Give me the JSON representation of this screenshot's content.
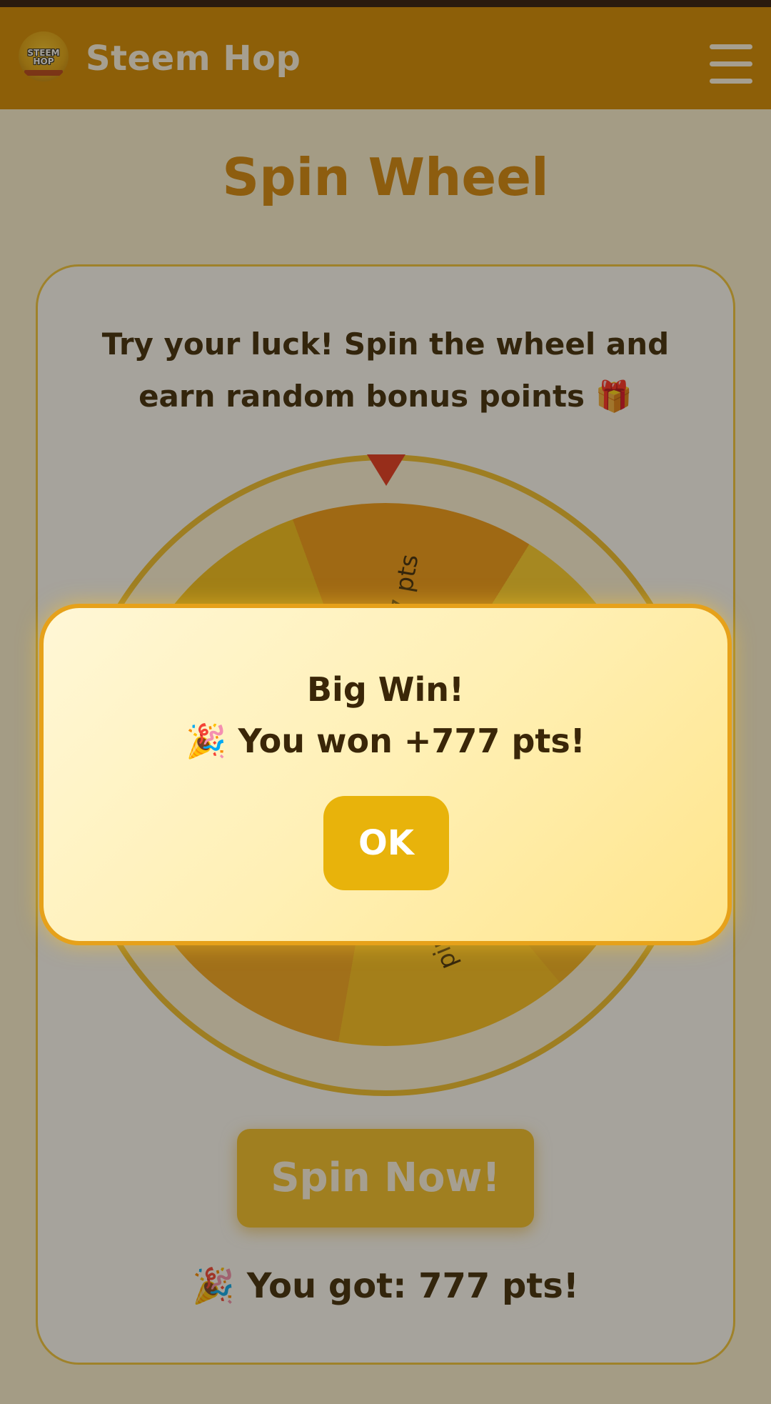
{
  "header": {
    "app_title": "Steem Hop",
    "logo_text": "STEEM HOP",
    "menu_icon": "hamburger-menu-icon"
  },
  "page": {
    "title": "Spin Wheel",
    "intro_line1": "Try your luck! Spin the wheel and",
    "intro_line2": "earn random bonus points 🎁"
  },
  "wheel": {
    "labels": [
      "7 pts",
      "pin"
    ]
  },
  "spin_button": {
    "label": "Spin Now!"
  },
  "result": {
    "text": "🎉 You got: 777 pts!"
  },
  "modal": {
    "title": "Big Win!",
    "message": "🎉 You won +777 pts!",
    "ok_label": "OK"
  },
  "colors": {
    "header": "#d58a00",
    "title": "#d4870d",
    "accent": "#f5c12a",
    "pointer": "#e6341f"
  }
}
